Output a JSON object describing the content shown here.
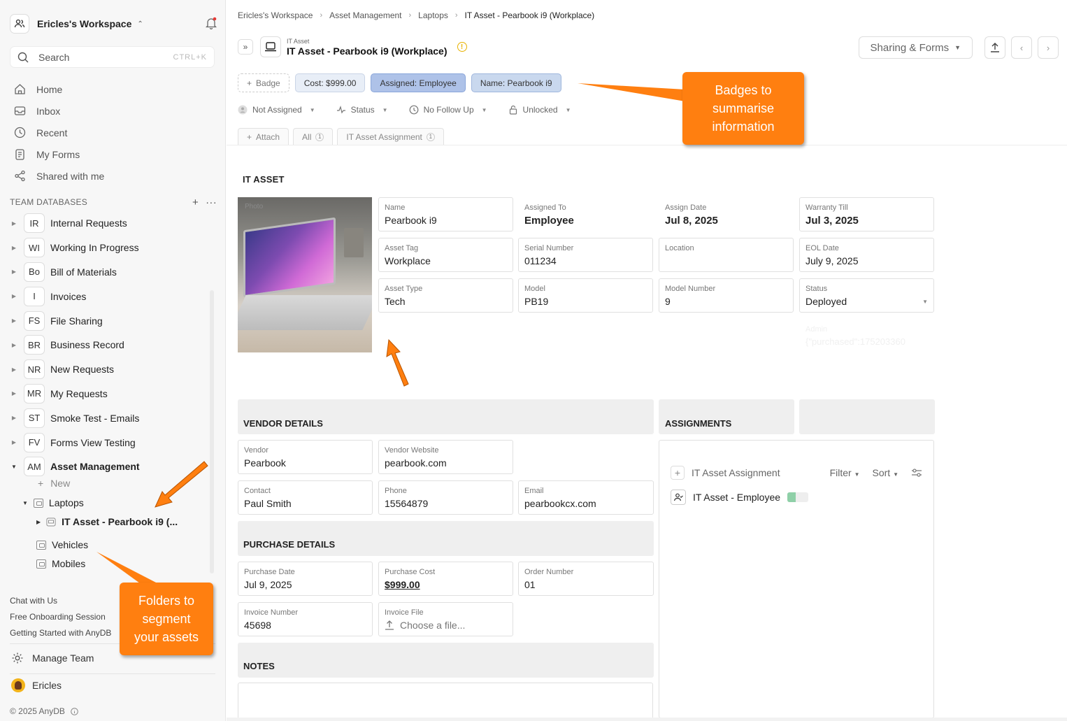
{
  "sidebar": {
    "workspace": "Ericles's Workspace",
    "search_placeholder": "Search",
    "search_shortcut": "CTRL+K",
    "nav": [
      {
        "label": "Home",
        "icon": "home-icon"
      },
      {
        "label": "Inbox",
        "icon": "inbox-icon"
      },
      {
        "label": "Recent",
        "icon": "clock-icon"
      },
      {
        "label": "My Forms",
        "icon": "form-icon"
      },
      {
        "label": "Shared with me",
        "icon": "share-icon"
      }
    ],
    "team_databases_label": "TEAM DATABASES",
    "databases": [
      {
        "abbr": "IR",
        "name": "Internal Requests"
      },
      {
        "abbr": "WI",
        "name": "Working In Progress"
      },
      {
        "abbr": "Bo",
        "name": "Bill of Materials"
      },
      {
        "abbr": "I",
        "name": "Invoices"
      },
      {
        "abbr": "FS",
        "name": "File Sharing"
      },
      {
        "abbr": "BR",
        "name": "Business Record"
      },
      {
        "abbr": "NR",
        "name": "New Requests"
      },
      {
        "abbr": "MR",
        "name": "My Requests"
      },
      {
        "abbr": "ST",
        "name": "Smoke Test - Emails"
      },
      {
        "abbr": "FV",
        "name": "Forms View Testing"
      },
      {
        "abbr": "AM",
        "name": "Asset Management"
      }
    ],
    "new_label": "New",
    "folders": {
      "laptops": "Laptops",
      "record": "IT Asset - Pearbook i9 (...",
      "vehicles": "Vehicles",
      "mobiles": "Mobiles"
    },
    "footer_links": [
      "Chat with Us",
      "Free Onboarding Session",
      "Getting Started with AnyDB"
    ],
    "manage_team": "Manage Team",
    "user_name": "Ericles",
    "copyright": "© 2025 AnyDB"
  },
  "main": {
    "breadcrumb": [
      "Ericles's Workspace",
      "Asset Management",
      "Laptops",
      "IT Asset - Pearbook i9 (Workplace)"
    ],
    "kicker": "IT Asset",
    "title": "IT Asset - Pearbook i9 (Workplace)",
    "sharing_label": "Sharing & Forms",
    "badges": {
      "add": "Badge",
      "cost": "Cost: $999.00",
      "assigned": "Assigned: Employee",
      "name": "Name: Pearbook i9"
    },
    "props": {
      "assignee": "Not Assigned",
      "status": "Status",
      "followup": "No Follow Up",
      "lock": "Unlocked"
    },
    "tabs": {
      "attach": "Attach",
      "all": "All",
      "all_count": "1",
      "assignment": "IT Asset Assignment",
      "assignment_count": "1"
    },
    "section_it_asset": "IT ASSET",
    "photo_label": "Photo",
    "fields": {
      "name": {
        "label": "Name",
        "value": "Pearbook i9"
      },
      "assigned_to": {
        "label": "Assigned To",
        "value": "Employee"
      },
      "assign_date": {
        "label": "Assign Date",
        "value": "Jul 8, 2025"
      },
      "warranty": {
        "label": "Warranty Till",
        "value": "Jul 3, 2025"
      },
      "asset_tag": {
        "label": "Asset Tag",
        "value": "Workplace"
      },
      "serial": {
        "label": "Serial Number",
        "value": "011234"
      },
      "location": {
        "label": "Location",
        "value": ""
      },
      "eol": {
        "label": "EOL Date",
        "value": "July 9, 2025"
      },
      "asset_type": {
        "label": "Asset Type",
        "value": "Tech"
      },
      "model": {
        "label": "Model",
        "value": "PB19"
      },
      "model_number": {
        "label": "Model Number",
        "value": "9"
      },
      "status": {
        "label": "Status",
        "value": "Deployed"
      }
    },
    "ghost": {
      "label": "Admin",
      "value": "{\"purchased\":175203360"
    },
    "vendor_section": "VENDOR DETAILS",
    "vendor": {
      "vendor": {
        "label": "Vendor",
        "value": "Pearbook"
      },
      "website": {
        "label": "Vendor Website",
        "value": "pearbook.com"
      },
      "contact": {
        "label": "Contact",
        "value": "Paul Smith"
      },
      "phone": {
        "label": "Phone",
        "value": "15564879"
      },
      "email": {
        "label": "Email",
        "value": "pearbookcx.com"
      }
    },
    "purchase_section": "PURCHASE DETAILS",
    "purchase": {
      "date": {
        "label": "Purchase Date",
        "value": "Jul 9, 2025"
      },
      "cost": {
        "label": "Purchase Cost",
        "value": "$999.00"
      },
      "order": {
        "label": "Order Number",
        "value": "01"
      },
      "invoice_number": {
        "label": "Invoice Number",
        "value": "45698"
      },
      "invoice_file": {
        "label": "Invoice File",
        "value": "Choose a file..."
      }
    },
    "notes_section": "NOTES",
    "assignments_section": "ASSIGNMENTS",
    "assignments": {
      "add_label": "IT Asset Assignment",
      "filter": "Filter",
      "sort": "Sort",
      "row": "IT Asset - Employee",
      "row_progress": 0.4
    }
  },
  "callouts": {
    "badges": "Badges to summarise information",
    "folders": "Folders to segment your assets"
  },
  "colors": {
    "accent": "#ff7f10",
    "badge_assigned": "#aec2e8"
  }
}
